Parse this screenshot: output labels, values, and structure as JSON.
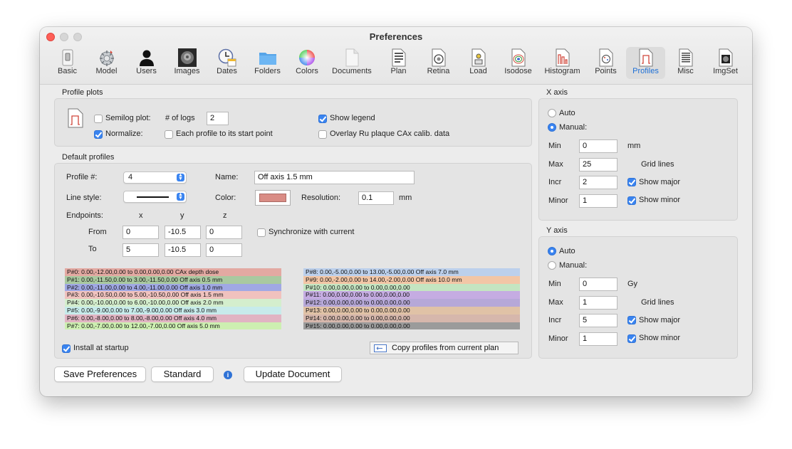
{
  "window": {
    "title": "Preferences"
  },
  "toolbar": {
    "items": [
      {
        "label": "Basic",
        "icon": "switch-icon"
      },
      {
        "label": "Model",
        "icon": "gear-sphere-icon"
      },
      {
        "label": "Users",
        "icon": "person-icon"
      },
      {
        "label": "Images",
        "icon": "scan-image-icon"
      },
      {
        "label": "Dates",
        "icon": "calendar-clock-icon"
      },
      {
        "label": "Folders",
        "icon": "folder-icon"
      },
      {
        "label": "Colors",
        "icon": "color-wheel-icon"
      },
      {
        "label": "Documents",
        "icon": "document-icon"
      },
      {
        "label": "Plan",
        "icon": "plan-doc-icon"
      },
      {
        "label": "Retina",
        "icon": "retina-doc-icon"
      },
      {
        "label": "Load",
        "icon": "load-doc-icon"
      },
      {
        "label": "Isodose",
        "icon": "isodose-doc-icon"
      },
      {
        "label": "Histogram",
        "icon": "histogram-doc-icon"
      },
      {
        "label": "Points",
        "icon": "points-doc-icon"
      },
      {
        "label": "Profiles",
        "icon": "profiles-doc-icon"
      },
      {
        "label": "Misc",
        "icon": "misc-doc-icon"
      },
      {
        "label": "ImgSet",
        "icon": "imgset-doc-icon"
      }
    ],
    "selected": "Profiles"
  },
  "profile_plots": {
    "title": "Profile plots",
    "semilog_label": "Semilog plot:",
    "semilog_checked": false,
    "num_logs_label": "# of logs",
    "num_logs_value": "2",
    "show_legend_label": "Show legend",
    "show_legend_checked": true,
    "normalize_label": "Normalize:",
    "normalize_checked": true,
    "each_profile_label": "Each profile to its start point",
    "each_profile_checked": false,
    "overlay_label": "Overlay Ru plaque CAx calib. data",
    "overlay_checked": false
  },
  "default_profiles": {
    "title": "Default profiles",
    "profile_num_label": "Profile #:",
    "profile_num_value": "4",
    "name_label": "Name:",
    "name_value": "Off axis 1.5 mm",
    "line_style_label": "Line style:",
    "color_label": "Color:",
    "color_value": "#d98c85",
    "resolution_label": "Resolution:",
    "resolution_value": "0.1",
    "resolution_unit": "mm",
    "endpoints_label": "Endpoints:",
    "col_x": "x",
    "col_y": "y",
    "col_z": "z",
    "from_label": "From",
    "from": [
      "0",
      "-10.5",
      "0"
    ],
    "to_label": "To",
    "to": [
      "5",
      "-10.5",
      "0"
    ],
    "sync_label": "Synchronize with current",
    "sync_checked": false,
    "list_left": [
      {
        "text": "P#0: 0.00,-12.00,0.00 to 0.00,0.00,0.00 CAx depth dose",
        "color": "#e3a9a2"
      },
      {
        "text": "P#1: 0.00,-11.50,0.00 to 3.00,-11.50,0.00 Off axis 0.5 mm",
        "color": "#a9c9a0"
      },
      {
        "text": "P#2: 0.00,-11.00,0.00 to 4.00,-11.00,0.00 Off axis 1.0 mm",
        "color": "#a0a8e4"
      },
      {
        "text": "P#3: 0.00,-10.50,0.00 to 5.00,-10.50,0.00 Off axis 1.5 mm",
        "color": "#f0c2be"
      },
      {
        "text": "P#4: 0.00,-10.00,0.00 to 6.00,-10.00,0.00 Off axis 2.0 mm",
        "color": "#d4eecd"
      },
      {
        "text": "P#5: 0.00,-9.00,0.00 to 7.00,-9.00,0.00 Off axis 3.0 mm",
        "color": "#c7ebeb"
      },
      {
        "text": "P#6: 0.00,-8.00,0.00 to 8.00,-8.00,0.00 Off axis 4.0 mm",
        "color": "#e1b4c3"
      },
      {
        "text": "P#7: 0.00,-7.00,0.00 to 12.00,-7.00,0.00 Off axis 5.0 mm",
        "color": "#cdefb1"
      }
    ],
    "list_right": [
      {
        "text": "P#8: 0.00,-5.00,0.00 to 13.00,-5.00,0.00 Off axis 7.0 mm",
        "color": "#bcd0ec"
      },
      {
        "text": "P#9: 0.00,-2.00,0.00 to 14.00,-2.00,0.00 Off axis 10.0 mm",
        "color": "#f2c6a6"
      },
      {
        "text": "P#10: 0.00,0.00,0.00 to 0.00,0.00,0.00",
        "color": "#c4e5c1"
      },
      {
        "text": "P#11: 0.00,0.00,0.00 to 0.00,0.00,0.00",
        "color": "#c5ace2"
      },
      {
        "text": "P#12: 0.00,0.00,0.00 to 0.00,0.00,0.00",
        "color": "#b6a8d8"
      },
      {
        "text": "P#13: 0.00,0.00,0.00 to 0.00,0.00,0.00",
        "color": "#e0c2a6"
      },
      {
        "text": "P#14: 0.00,0.00,0.00 to 0.00,0.00,0.00",
        "color": "#d6b7ac"
      },
      {
        "text": "P#15: 0.00,0.00,0.00 to 0.00,0.00,0.00",
        "color": "#9b9b9b"
      }
    ],
    "install_label": "Install at startup",
    "install_checked": true,
    "copy_button": "Copy profiles from current plan"
  },
  "x_axis": {
    "title": "X axis",
    "auto_label": "Auto",
    "manual_label": "Manual:",
    "mode": "manual",
    "min_label": "Min",
    "min_value": "0",
    "unit": "mm",
    "max_label": "Max",
    "max_value": "25",
    "grid_lines_label": "Grid lines",
    "incr_label": "Incr",
    "incr_value": "2",
    "show_major_label": "Show major",
    "show_major_checked": true,
    "minor_label": "Minor",
    "minor_value": "1",
    "show_minor_label": "Show minor",
    "show_minor_checked": true
  },
  "y_axis": {
    "title": "Y axis",
    "auto_label": "Auto",
    "manual_label": "Manual:",
    "mode": "auto",
    "min_label": "Min",
    "min_value": "0",
    "unit": "Gy",
    "max_label": "Max",
    "max_value": "1",
    "grid_lines_label": "Grid lines",
    "incr_label": "Incr",
    "incr_value": "5",
    "show_major_label": "Show major",
    "show_major_checked": true,
    "minor_label": "Minor",
    "minor_value": "1",
    "show_minor_label": "Show minor",
    "show_minor_checked": true
  },
  "buttons": {
    "save": "Save Preferences",
    "standard": "Standard",
    "info_glyph": "i",
    "update": "Update Document"
  }
}
